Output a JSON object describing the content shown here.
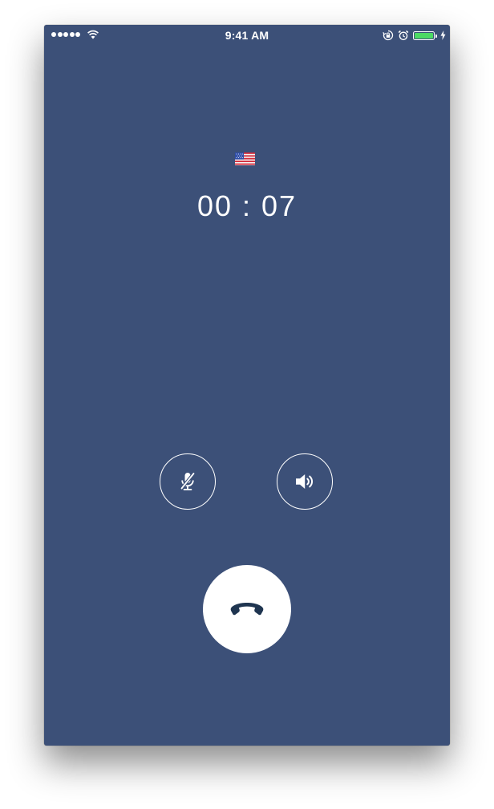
{
  "status_bar": {
    "time": "9:41 AM",
    "signal_bars": 5,
    "battery_level": 1.0,
    "battery_color": "#4cd964",
    "icons": [
      "signal-dots-icon",
      "wifi-icon",
      "rotation-lock-icon",
      "alarm-icon",
      "battery-icon",
      "charging-bolt-icon"
    ]
  },
  "call": {
    "country_flag": "us-flag-icon",
    "duration": "00 : 07"
  },
  "controls": {
    "mute": {
      "icon": "microphone-muted-icon"
    },
    "speaker": {
      "icon": "speaker-icon"
    },
    "end_call": {
      "icon": "phone-hangup-icon",
      "icon_color": "#1f3550"
    }
  },
  "colors": {
    "background": "#3c5078",
    "foreground": "#ffffff"
  }
}
